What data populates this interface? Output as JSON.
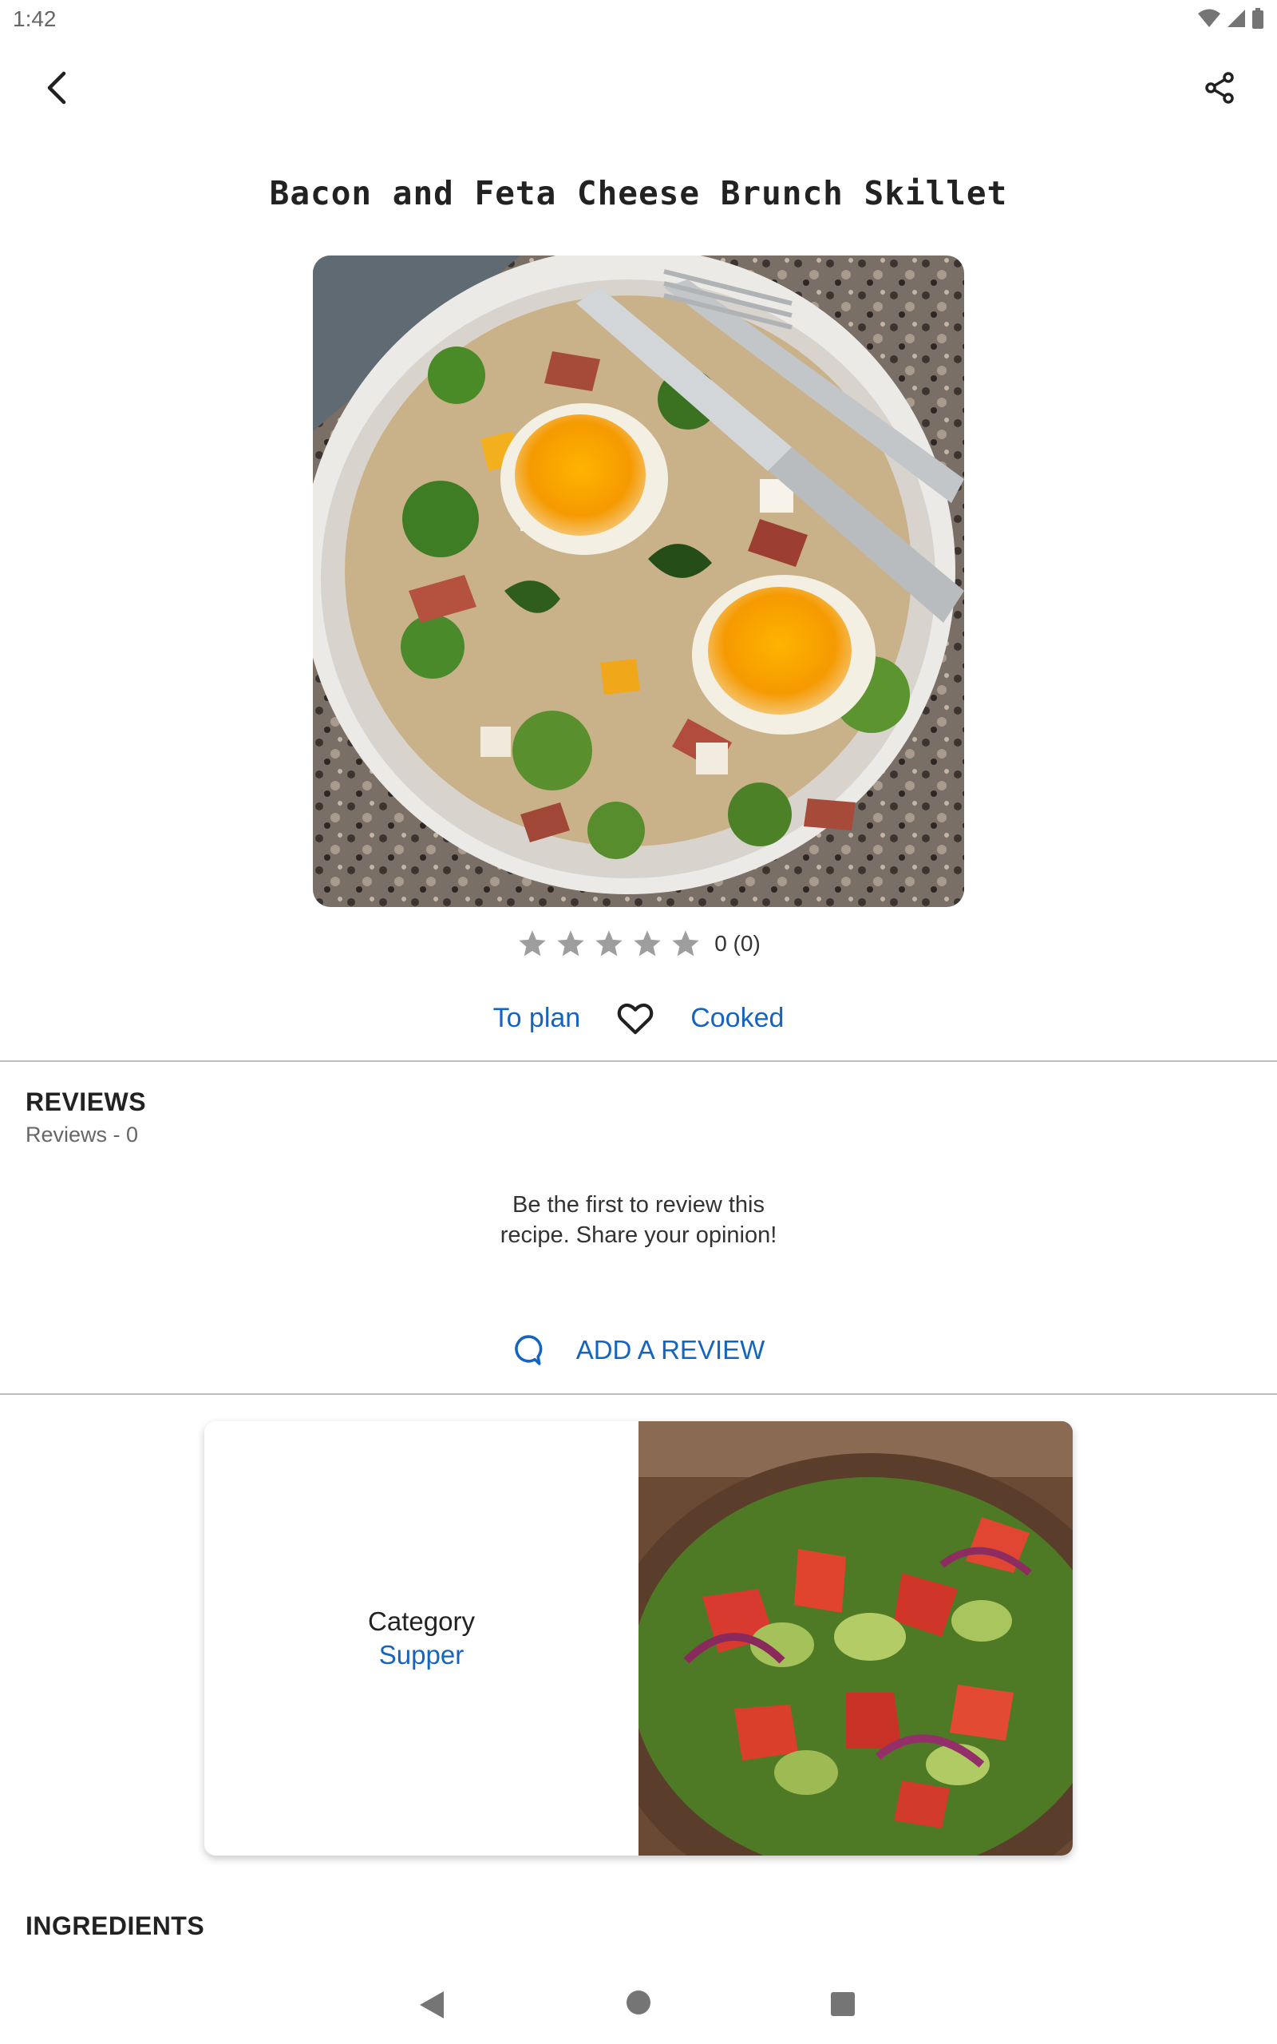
{
  "status_bar": {
    "time": "1:42"
  },
  "app_bar": {
    "back_icon": "chevron-left-icon",
    "share_icon": "share-icon"
  },
  "recipe": {
    "title": "Bacon and Feta Cheese Brunch Skillet",
    "rating": {
      "stars_filled": 0,
      "stars_total": 5,
      "text": "0 (0)"
    }
  },
  "actions": {
    "to_plan": "To plan",
    "favorite_icon": "heart-outline-icon",
    "cooked": "Cooked"
  },
  "reviews": {
    "heading": "REVIEWS",
    "count_text": "Reviews - 0",
    "empty_line1": "Be the first to review this",
    "empty_line2": "recipe. Share your opinion!",
    "add_label": "ADD A REVIEW"
  },
  "category_card": {
    "label": "Category",
    "value": "Supper"
  },
  "ingredients": {
    "heading": "INGREDIENTS"
  },
  "colors": {
    "accent": "#1565c0",
    "divider": "#bdbdbd",
    "star": "#9e9e9e"
  }
}
